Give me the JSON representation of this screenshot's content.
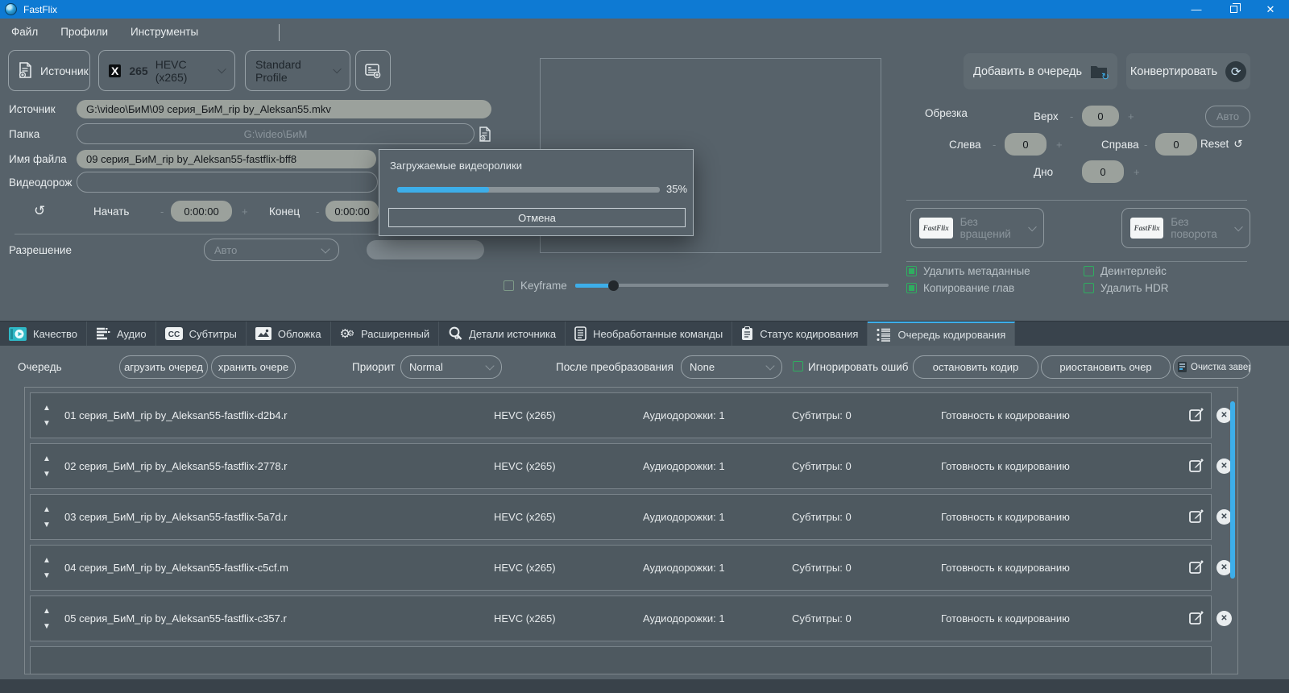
{
  "window": {
    "title": "FastFlix"
  },
  "menu": {
    "items": [
      "Файл",
      "Профили",
      "Инструменты"
    ]
  },
  "toolbar": {
    "source_button": "Источник",
    "encoder_logo_x": "X",
    "encoder_logo_265": "265",
    "encoder_value": "HEVC (x265)",
    "profile_value": "Standard Profile",
    "add_to_queue": "Добавить в очередь",
    "convert": "Конвертировать"
  },
  "form": {
    "source_label": "Источник",
    "source_value": "G:\\video\\БиМ\\09 серия_БиМ_rip by_Aleksan55.mkv",
    "folder_label": "Папка",
    "folder_placeholder": "G:\\video\\БиМ",
    "filename_label": "Имя файла",
    "filename_value": "09 серия_БиМ_rip by_Aleksan55-fastflix-bff8",
    "videotrack_label": "Видеодорож",
    "start_label": "Начать",
    "start_value": "0:00:00",
    "end_label": "Конец",
    "end_value": "0:00:00",
    "minus": "-",
    "plus": "+",
    "resolution_label": "Разрешение",
    "resolution_value": "Авто",
    "keyframe_label": "Keyframe"
  },
  "crop": {
    "label": "Обрезка",
    "top_label": "Верх",
    "top_value": "0",
    "left_label": "Слева",
    "left_value": "0",
    "right_label": "Справа",
    "right_value": "0",
    "bottom_label": "Дно",
    "bottom_value": "0",
    "auto_button": "Авто",
    "reset_button": "Reset",
    "reset_icon": "↺"
  },
  "transform": {
    "rotation_value": "Без вращений",
    "flip_value": "Без поворота",
    "logo_text": "FastFlix"
  },
  "options": {
    "remove_metadata": "Удалить метаданные",
    "copy_chapters": "Копирование глав",
    "deinterlace": "Деинтерлейс",
    "remove_hdr": "Удалить HDR"
  },
  "dialog": {
    "title": "Загружаемые видеоролики",
    "progress": 35,
    "progress_label": "35%",
    "cancel": "Отмена"
  },
  "tabs": [
    {
      "label": "Качество",
      "icon": "quality-video-icon"
    },
    {
      "label": "Аудио",
      "icon": "audio-equalizer-icon"
    },
    {
      "label": "Субтитры",
      "icon": "subtitles-cc-icon"
    },
    {
      "label": "Обложка",
      "icon": "cover-image-icon"
    },
    {
      "label": "Расширенный",
      "icon": "advanced-gears-icon"
    },
    {
      "label": "Детали источника",
      "icon": "source-details-magnifier-icon"
    },
    {
      "label": "Необработанные команды",
      "icon": "raw-commands-document-icon"
    },
    {
      "label": "Статус кодирования",
      "icon": "status-clipboard-icon"
    },
    {
      "label": "Очередь кодирования",
      "icon": "queue-list-icon"
    }
  ],
  "queue": {
    "label": "Очередь",
    "load_button": "агрузить очеред",
    "save_button": "хранить очере",
    "priority_label": "Приорит",
    "priority_value": "Normal",
    "after_label": "После преобразования",
    "after_value": "None",
    "ignore_errors_label": "Игнорировать ошиб",
    "stop_button": "остановить кодир",
    "pause_button": "риостановить очер",
    "clear_button": "Очистка завершена",
    "rows": [
      {
        "name": "01 серия_БиМ_rip by_Aleksan55-fastflix-d2b4.r",
        "codec": "HEVC (x265)",
        "audio": "Аудиодорожки: 1",
        "subtitles": "Субтитры: 0",
        "status": "Готовность к кодированию"
      },
      {
        "name": "02 серия_БиМ_rip by_Aleksan55-fastflix-2778.r",
        "codec": "HEVC (x265)",
        "audio": "Аудиодорожки: 1",
        "subtitles": "Субтитры: 0",
        "status": "Готовность к кодированию"
      },
      {
        "name": "03 серия_БиМ_rip by_Aleksan55-fastflix-5a7d.r",
        "codec": "HEVC (x265)",
        "audio": "Аудиодорожки: 1",
        "subtitles": "Субтитры: 0",
        "status": "Готовность к кодированию"
      },
      {
        "name": "04 серия_БиМ_rip by_Aleksan55-fastflix-c5cf.m",
        "codec": "HEVC (x265)",
        "audio": "Аудиодорожки: 1",
        "subtitles": "Субтитры: 0",
        "status": "Готовность к кодированию"
      },
      {
        "name": "05 серия_БиМ_rip by_Aleksan55-fastflix-c357.r",
        "codec": "HEVC (x265)",
        "audio": "Аудиодорожки: 1",
        "subtitles": "Субтитры: 0",
        "status": "Готовность к кодированию"
      }
    ]
  },
  "colors": {
    "titlebar": "#0e7ad3",
    "accent_blue": "#3daee9",
    "checkbox_green": "#2fae60",
    "window_bg": "#57626a"
  }
}
